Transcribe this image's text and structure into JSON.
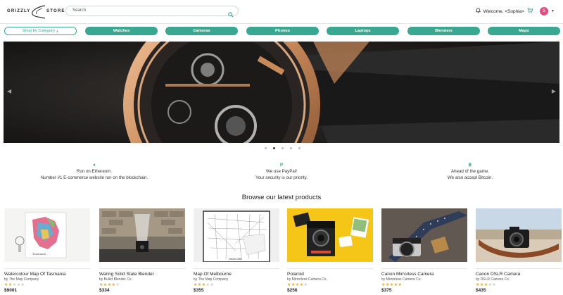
{
  "header": {
    "logo_left": "GRIZZLY",
    "logo_right": "STORE",
    "search_placeholder": "Search",
    "welcome": "Welcome, <Sophia>",
    "avatar_initial": "S"
  },
  "categories": {
    "shop_label": "Shop by Category",
    "items": [
      "Watches",
      "Cameras",
      "Phones",
      "Laptops",
      "Blenders",
      "Maps"
    ]
  },
  "carousel": {
    "slide_count": 5,
    "active_index": 1
  },
  "features": [
    {
      "icon": "ethereum-icon",
      "line1": "Run on Ethereum.",
      "line2": "Number #1 E-commerce website run on the blockchain."
    },
    {
      "icon": "paypal-icon",
      "line1": "We use PayPal!",
      "line2": "Your security is our priority."
    },
    {
      "icon": "bitcoin-icon",
      "line1": "Ahead of the game.",
      "line2": "We also accept Bitcoin."
    }
  ],
  "browse_title": "Browse our latest products",
  "products": [
    {
      "name": "Watercolour Map Of Tasmania",
      "by": "by The Map Company",
      "rating": 2,
      "price": "$9001"
    },
    {
      "name": "Waring Solid State Blender",
      "by": "by Bullet Blender Co.",
      "rating": 4,
      "price": "$334"
    },
    {
      "name": "Map Of Melbourne",
      "by": "by The Map Company",
      "rating": 3,
      "price": "$355"
    },
    {
      "name": "Polaroid",
      "by": "by Mirrorless Camera Co.",
      "rating": 4,
      "price": "$256"
    },
    {
      "name": "Canon Mirrorless Camera",
      "by": "by Mirrorless Camera Co.",
      "rating": 5,
      "price": "$375"
    },
    {
      "name": "Canon DSLR Camera",
      "by": "by DSLR Camera Co.",
      "rating": 3,
      "price": "$435"
    }
  ],
  "colors": {
    "accent": "#3aa890",
    "star": "#f0a81a",
    "avatar": "#e24c7f"
  }
}
